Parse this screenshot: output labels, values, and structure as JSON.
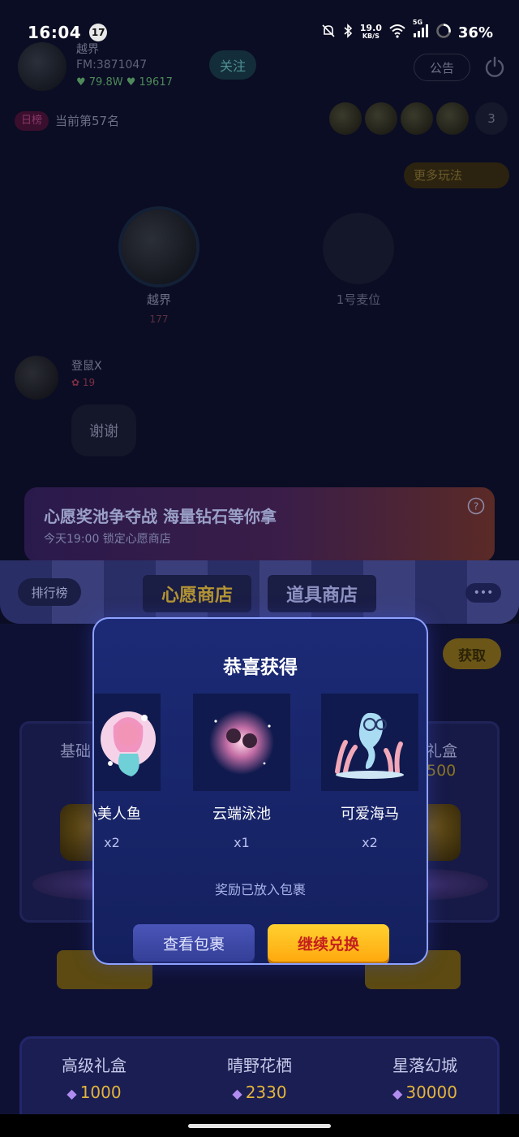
{
  "status_bar": {
    "time": "16:04",
    "notification_count": "17",
    "net_speed_value": "19.0",
    "net_speed_unit": "KB/S",
    "network_type": "5G",
    "battery_percent": "36%"
  },
  "room": {
    "host_name": "越界",
    "host_id": "FM:3871047",
    "host_stats": "♥ 79.8W   ♥ 19617",
    "follow_label": "关注",
    "notice_label": "公告",
    "rank_tag": "日榜",
    "rank_text": "当前第57名",
    "viewer_count": "3",
    "play_label": "更多玩法",
    "seat_host_name": "越界",
    "seat_host_score": "177",
    "seat_empty_label": "1号麦位",
    "chat_user": "登鼠X",
    "chat_badge": "✿ 19",
    "chat_message": "谢谢"
  },
  "shop": {
    "banner_title": "心愿奖池争夺战 海量钻石等你拿",
    "banner_subtitle": "今天19:00 锁定心愿商店",
    "rank_board_label": "排行榜",
    "tabs": [
      {
        "label": "心愿商店"
      },
      {
        "label": "道具商店"
      }
    ],
    "more_label": "•••",
    "get_label": "获取",
    "left_gift_label": "基础",
    "right_gift_label": "礼盒",
    "right_gift_price": "500",
    "bottom_items": [
      {
        "name": "高级礼盒",
        "price": "1000"
      },
      {
        "name": "晴野花栖",
        "price": "2330"
      },
      {
        "name": "星落幻城",
        "price": "30000"
      }
    ]
  },
  "modal": {
    "title": "恭喜获得",
    "rewards": [
      {
        "name": "小美人鱼",
        "quantity": "x2"
      },
      {
        "name": "云端泳池",
        "quantity": "x1"
      },
      {
        "name": "可爱海马",
        "quantity": "x2"
      }
    ],
    "note": "奖励已放入包裹",
    "view_bag_label": "查看包裹",
    "continue_label": "继续兑换"
  }
}
